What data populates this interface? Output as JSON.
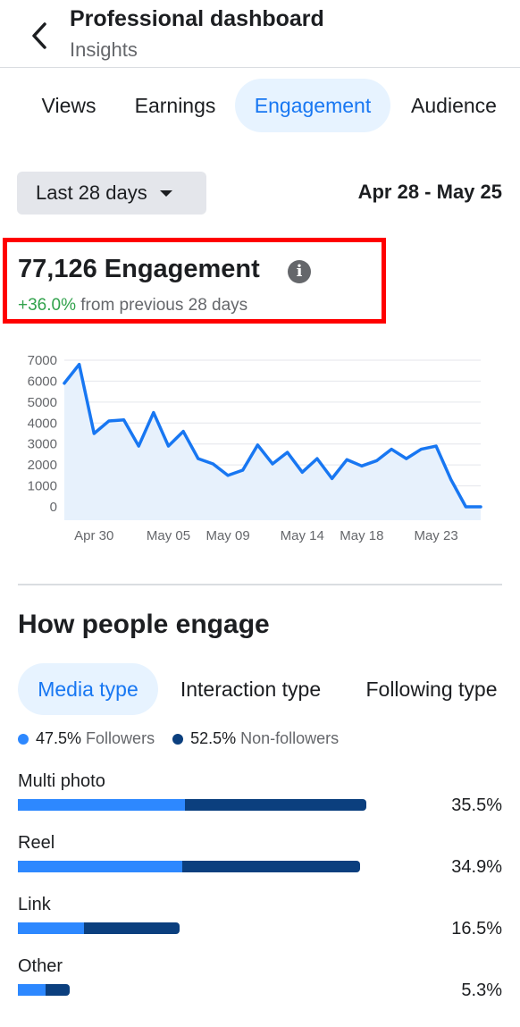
{
  "header": {
    "title": "Professional dashboard",
    "subtitle": "Insights"
  },
  "tabs": [
    {
      "label": "Views"
    },
    {
      "label": "Earnings"
    },
    {
      "label": "Engagement",
      "active": true
    },
    {
      "label": "Audience"
    }
  ],
  "filter": {
    "range_label": "Last 28 days",
    "date_range": "Apr 28 - May 25"
  },
  "metric": {
    "value": "77,126 Engagement",
    "change": "+36.0%",
    "change_text": "from previous 28 days"
  },
  "chart_data": {
    "type": "area",
    "y_ticks": [
      "7000",
      "6000",
      "5000",
      "4000",
      "3000",
      "2000",
      "1000",
      "0"
    ],
    "x_tick_labels": [
      "Apr 30",
      "May 05",
      "May 09",
      "May 14",
      "May 18",
      "May 23"
    ],
    "x_ticks_at_day": [
      3,
      8,
      12,
      17,
      21,
      26
    ],
    "ylim": [
      0,
      7000
    ],
    "grid": true,
    "color": "#1877f2",
    "fill": "#e7f1fc",
    "x": [
      1,
      2,
      3,
      4,
      5,
      6,
      7,
      8,
      9,
      10,
      11,
      12,
      13,
      14,
      15,
      16,
      17,
      18,
      19,
      20,
      21,
      22,
      23,
      24,
      25,
      26,
      27,
      28,
      29
    ],
    "values": [
      5900,
      6800,
      3500,
      4100,
      4150,
      2900,
      4500,
      2900,
      3600,
      2300,
      2050,
      1500,
      1750,
      2950,
      2050,
      2600,
      1650,
      2300,
      1350,
      2250,
      1950,
      2200,
      2750,
      2300,
      2750,
      2900,
      1300,
      0,
      0
    ]
  },
  "section": {
    "title": "How people engage",
    "subtabs": [
      {
        "label": "Media type",
        "active": true
      },
      {
        "label": "Interaction type"
      },
      {
        "label": "Following type"
      }
    ],
    "legend": {
      "followers_pct": "47.5%",
      "followers_label": "Followers",
      "nonfollowers_pct": "52.5%",
      "nonfollowers_label": "Non-followers",
      "followers_color": "#2d88ff",
      "nonfollowers_color": "#0b3f7e"
    },
    "rows": [
      {
        "label": "Multi photo",
        "pct": "35.5%",
        "total": 35.5,
        "followers_share": 0.48
      },
      {
        "label": "Reel",
        "pct": "34.9%",
        "total": 34.9,
        "followers_share": 0.48
      },
      {
        "label": "Link",
        "pct": "16.5%",
        "total": 16.5,
        "followers_share": 0.41
      },
      {
        "label": "Other",
        "pct": "5.3%",
        "total": 5.3,
        "followers_share": 0.53
      }
    ]
  }
}
